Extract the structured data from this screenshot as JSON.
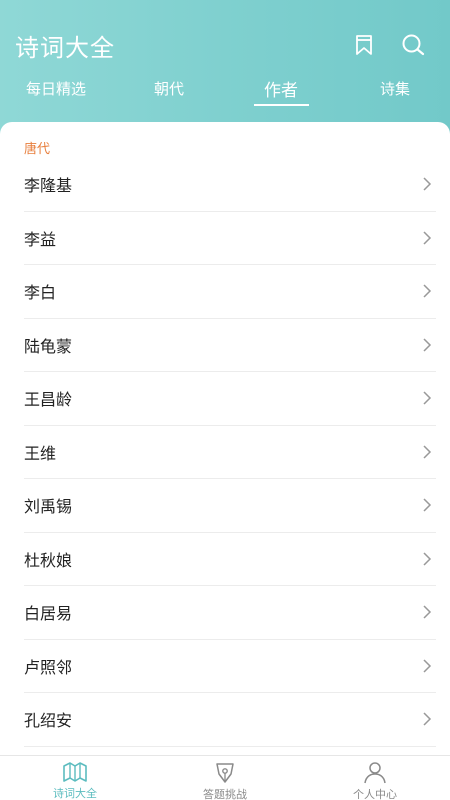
{
  "header": {
    "title": "诗词大全",
    "icons": {
      "bookmark": "bookmark-icon",
      "search": "search-icon"
    }
  },
  "tabs": [
    {
      "label": "每日精选",
      "active": false
    },
    {
      "label": "朝代",
      "active": false
    },
    {
      "label": "作者",
      "active": true
    },
    {
      "label": "诗集",
      "active": false
    }
  ],
  "section": {
    "label": "唐代"
  },
  "authors": [
    "李隆基",
    "李益",
    "李白",
    "陆龟蒙",
    "王昌龄",
    "王维",
    "刘禹锡",
    "杜秋娘",
    "白居易",
    "卢照邻",
    "孔绍安"
  ],
  "bottom_nav": [
    {
      "label": "诗词大全",
      "icon": "book-map-icon",
      "active": true
    },
    {
      "label": "答题挑战",
      "icon": "pen-nib-icon",
      "active": false
    },
    {
      "label": "个人中心",
      "icon": "user-icon",
      "active": false
    }
  ],
  "colors": {
    "header_gradient_start": "#8fd8d6",
    "header_gradient_end": "#72c9c9",
    "accent": "#5cbcbf",
    "section_label": "#e8803f"
  }
}
